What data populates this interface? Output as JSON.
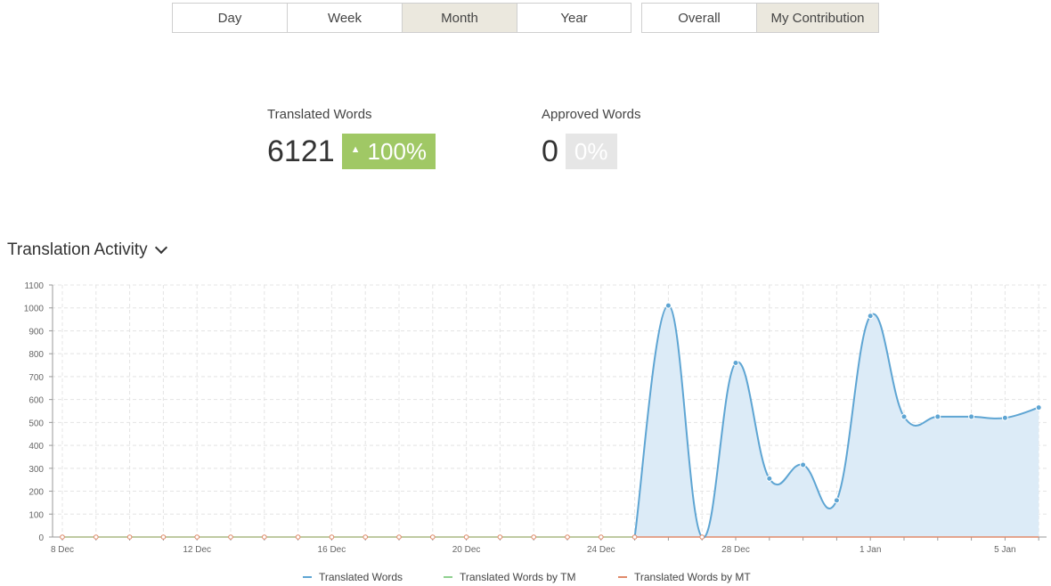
{
  "period_tabs": [
    {
      "label": "Day",
      "active": false
    },
    {
      "label": "Week",
      "active": false
    },
    {
      "label": "Month",
      "active": true
    },
    {
      "label": "Year",
      "active": false
    }
  ],
  "scope_tabs": [
    {
      "label": "Overall",
      "active": false
    },
    {
      "label": "My Contribution",
      "active": true
    }
  ],
  "stats": {
    "translated": {
      "label": "Translated Words",
      "value": "6121",
      "change": "100%"
    },
    "approved": {
      "label": "Approved Words",
      "value": "0",
      "change": "0%"
    }
  },
  "section": {
    "title": "Translation Activity"
  },
  "colors": {
    "translated": "#5ea5d3",
    "tm": "#8fd08f",
    "mt": "#e08a6a",
    "area": "#dcebf7"
  },
  "chart_data": {
    "type": "area",
    "x": [
      "8 Dec",
      "9 Dec",
      "10 Dec",
      "11 Dec",
      "12 Dec",
      "13 Dec",
      "14 Dec",
      "15 Dec",
      "16 Dec",
      "17 Dec",
      "18 Dec",
      "19 Dec",
      "20 Dec",
      "21 Dec",
      "22 Dec",
      "23 Dec",
      "24 Dec",
      "25 Dec",
      "26 Dec",
      "27 Dec",
      "28 Dec",
      "29 Dec",
      "30 Dec",
      "31 Dec",
      "1 Jan",
      "2 Jan",
      "3 Jan",
      "4 Jan",
      "5 Jan",
      "6 Jan"
    ],
    "x_tick_labels": [
      "8 Dec",
      "12 Dec",
      "16 Dec",
      "20 Dec",
      "24 Dec",
      "28 Dec",
      "1 Jan",
      "5 Jan"
    ],
    "y_ticks": [
      0,
      100,
      200,
      300,
      400,
      500,
      600,
      700,
      800,
      900,
      1000,
      1100
    ],
    "ylim": [
      0,
      1100
    ],
    "grid": true,
    "legend_position": "bottom",
    "series": [
      {
        "name": "Translated Words",
        "values": [
          0,
          0,
          0,
          0,
          0,
          0,
          0,
          0,
          0,
          0,
          0,
          0,
          0,
          0,
          0,
          0,
          0,
          0,
          1010,
          0,
          760,
          255,
          315,
          160,
          965,
          525,
          525,
          525,
          520,
          565
        ]
      },
      {
        "name": "Translated Words by TM",
        "values": [
          0,
          0,
          0,
          0,
          0,
          0,
          0,
          0,
          0,
          0,
          0,
          0,
          0,
          0,
          0,
          0,
          0,
          0,
          0,
          0,
          0,
          0,
          0,
          0,
          0,
          0,
          0,
          0,
          0,
          0
        ]
      },
      {
        "name": "Translated Words by MT",
        "values": [
          0,
          0,
          0,
          0,
          0,
          0,
          0,
          0,
          0,
          0,
          0,
          0,
          0,
          0,
          0,
          0,
          0,
          0,
          0,
          0,
          0,
          0,
          0,
          0,
          0,
          0,
          0,
          0,
          0,
          0
        ]
      }
    ]
  }
}
